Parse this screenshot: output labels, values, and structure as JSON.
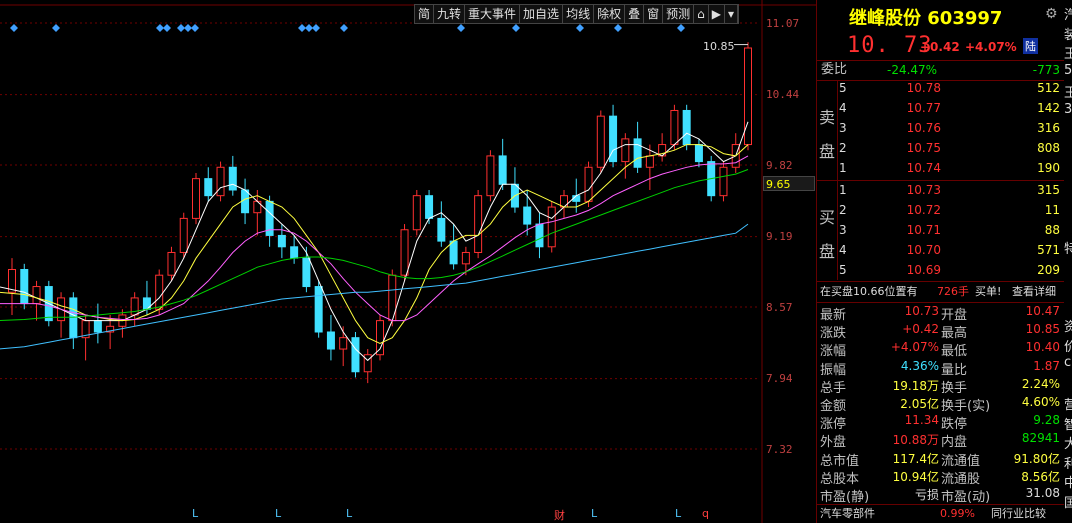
{
  "toolbar": {
    "items": [
      "简",
      "九转",
      "重大事件",
      "加自选",
      "均线",
      "除权",
      "叠",
      "窗",
      "预测",
      "⌂",
      "▶",
      "▾"
    ]
  },
  "chart": {
    "y_labels": [
      "11.07",
      "10.44",
      "9.82",
      "9.19",
      "8.57",
      "7.94",
      "7.32"
    ],
    "current_price_label": "9.65",
    "high_label": "10.85",
    "x_markers": [
      {
        "text": "L",
        "color": "cyan"
      },
      {
        "text": "L",
        "color": "cyan"
      },
      {
        "text": "L",
        "color": "cyan"
      },
      {
        "text": "财",
        "color": "red"
      },
      {
        "text": "L",
        "color": "cyan"
      },
      {
        "text": "L",
        "color": "cyan"
      },
      {
        "text": "q",
        "color": "red"
      }
    ]
  },
  "chart_data": {
    "type": "candlestick",
    "y_ticks": [
      11.07,
      10.44,
      9.82,
      9.19,
      8.57,
      7.94,
      7.32
    ],
    "ylim": [
      7.0,
      11.2
    ],
    "candles": [
      [
        8.7,
        9.0,
        8.5,
        8.9
      ],
      [
        8.9,
        8.95,
        8.55,
        8.6
      ],
      [
        8.6,
        8.8,
        8.45,
        8.75
      ],
      [
        8.75,
        8.8,
        8.4,
        8.45
      ],
      [
        8.45,
        8.7,
        8.3,
        8.65
      ],
      [
        8.65,
        8.7,
        8.2,
        8.3
      ],
      [
        8.3,
        8.5,
        8.1,
        8.45
      ],
      [
        8.45,
        8.6,
        8.25,
        8.35
      ],
      [
        8.35,
        8.5,
        8.2,
        8.4
      ],
      [
        8.4,
        8.55,
        8.3,
        8.5
      ],
      [
        8.5,
        8.7,
        8.4,
        8.65
      ],
      [
        8.65,
        8.8,
        8.5,
        8.55
      ],
      [
        8.55,
        8.9,
        8.5,
        8.85
      ],
      [
        8.85,
        9.1,
        8.8,
        9.05
      ],
      [
        9.05,
        9.4,
        9.0,
        9.35
      ],
      [
        9.35,
        9.75,
        9.3,
        9.7
      ],
      [
        9.7,
        9.8,
        9.5,
        9.55
      ],
      [
        9.55,
        9.85,
        9.5,
        9.8
      ],
      [
        9.8,
        9.9,
        9.55,
        9.6
      ],
      [
        9.6,
        9.7,
        9.3,
        9.4
      ],
      [
        9.4,
        9.6,
        9.2,
        9.5
      ],
      [
        9.5,
        9.55,
        9.1,
        9.2
      ],
      [
        9.2,
        9.3,
        9.0,
        9.1
      ],
      [
        9.1,
        9.2,
        8.95,
        9.0
      ],
      [
        9.0,
        9.1,
        8.7,
        8.75
      ],
      [
        8.75,
        8.8,
        8.3,
        8.35
      ],
      [
        8.35,
        8.5,
        8.1,
        8.2
      ],
      [
        8.2,
        8.4,
        8.05,
        8.3
      ],
      [
        8.3,
        8.35,
        7.95,
        8.0
      ],
      [
        8.0,
        8.2,
        7.9,
        8.15
      ],
      [
        8.15,
        8.5,
        8.1,
        8.45
      ],
      [
        8.45,
        8.9,
        8.4,
        8.85
      ],
      [
        8.85,
        9.3,
        8.8,
        9.25
      ],
      [
        9.25,
        9.6,
        9.2,
        9.55
      ],
      [
        9.55,
        9.6,
        9.3,
        9.35
      ],
      [
        9.35,
        9.5,
        9.1,
        9.15
      ],
      [
        9.15,
        9.3,
        8.9,
        8.95
      ],
      [
        8.95,
        9.1,
        8.85,
        9.05
      ],
      [
        9.05,
        9.6,
        9.0,
        9.55
      ],
      [
        9.55,
        9.95,
        9.5,
        9.9
      ],
      [
        9.9,
        10.05,
        9.6,
        9.65
      ],
      [
        9.65,
        9.8,
        9.4,
        9.45
      ],
      [
        9.45,
        9.6,
        9.2,
        9.3
      ],
      [
        9.3,
        9.4,
        9.0,
        9.1
      ],
      [
        9.1,
        9.5,
        9.05,
        9.45
      ],
      [
        9.45,
        9.6,
        9.35,
        9.55
      ],
      [
        9.55,
        9.7,
        9.4,
        9.5
      ],
      [
        9.5,
        9.85,
        9.45,
        9.8
      ],
      [
        9.8,
        10.3,
        9.75,
        10.25
      ],
      [
        10.25,
        10.35,
        9.8,
        9.85
      ],
      [
        9.85,
        10.1,
        9.7,
        10.05
      ],
      [
        10.05,
        10.2,
        9.75,
        9.8
      ],
      [
        9.8,
        10.0,
        9.6,
        9.9
      ],
      [
        9.9,
        10.1,
        9.85,
        10.0
      ],
      [
        10.0,
        10.35,
        9.95,
        10.3
      ],
      [
        10.3,
        10.35,
        9.95,
        10.0
      ],
      [
        10.0,
        10.05,
        9.8,
        9.85
      ],
      [
        9.85,
        9.9,
        9.5,
        9.55
      ],
      [
        9.55,
        9.85,
        9.5,
        9.8
      ],
      [
        9.8,
        10.1,
        9.75,
        10.0
      ],
      [
        10.0,
        10.9,
        9.95,
        10.85
      ]
    ],
    "ma_lines": {
      "white": [
        8.75,
        8.7,
        8.65,
        8.6,
        8.55,
        8.5,
        8.45,
        8.45,
        8.45,
        8.45,
        8.5,
        8.55,
        8.65,
        8.8,
        9.0,
        9.25,
        9.5,
        9.62,
        9.65,
        9.6,
        9.5,
        9.4,
        9.3,
        9.2,
        9.05,
        8.8,
        8.55,
        8.35,
        8.2,
        8.1,
        8.2,
        8.45,
        8.8,
        9.15,
        9.35,
        9.4,
        9.3,
        9.15,
        9.2,
        9.45,
        9.65,
        9.65,
        9.55,
        9.4,
        9.35,
        9.45,
        9.55,
        9.6,
        9.75,
        9.95,
        10.0,
        10.0,
        9.95,
        9.9,
        10.0,
        10.1,
        10.05,
        9.95,
        9.85,
        9.9,
        10.2
      ],
      "yellow": [
        8.7,
        8.68,
        8.65,
        8.62,
        8.58,
        8.55,
        8.5,
        8.48,
        8.46,
        8.45,
        8.46,
        8.5,
        8.55,
        8.65,
        8.8,
        9.0,
        9.15,
        9.3,
        9.45,
        9.52,
        9.55,
        9.5,
        9.45,
        9.35,
        9.2,
        9.05,
        8.85,
        8.65,
        8.45,
        8.3,
        8.25,
        8.3,
        8.45,
        8.65,
        8.9,
        9.05,
        9.15,
        9.2,
        9.2,
        9.3,
        9.45,
        9.55,
        9.6,
        9.55,
        9.5,
        9.45,
        9.45,
        9.5,
        9.6,
        9.7,
        9.8,
        9.88,
        9.9,
        9.92,
        9.95,
        10.0,
        10.0,
        9.98,
        9.92,
        9.9,
        10.0
      ],
      "purple": [
        8.6,
        8.6,
        8.6,
        8.58,
        8.55,
        8.52,
        8.5,
        8.48,
        8.47,
        8.46,
        8.46,
        8.47,
        8.5,
        8.55,
        8.6,
        8.7,
        8.8,
        8.92,
        9.05,
        9.15,
        9.22,
        9.25,
        9.25,
        9.22,
        9.15,
        9.05,
        8.95,
        8.82,
        8.7,
        8.6,
        8.5,
        8.45,
        8.45,
        8.5,
        8.6,
        8.7,
        8.8,
        8.88,
        8.95,
        9.02,
        9.1,
        9.18,
        9.25,
        9.3,
        9.32,
        9.35,
        9.38,
        9.42,
        9.48,
        9.55,
        9.6,
        9.65,
        9.7,
        9.74,
        9.77,
        9.8,
        9.82,
        9.83,
        9.83,
        9.84,
        9.9
      ],
      "green": [
        8.45,
        8.46,
        8.47,
        8.48,
        8.48,
        8.48,
        8.49,
        8.5,
        8.51,
        8.52,
        8.53,
        8.55,
        8.57,
        8.6,
        8.63,
        8.67,
        8.72,
        8.77,
        8.82,
        8.87,
        8.92,
        8.95,
        8.98,
        9.0,
        9.01,
        9.01,
        9.0,
        8.98,
        8.95,
        8.92,
        8.88,
        8.85,
        8.83,
        8.82,
        8.82,
        8.83,
        8.85,
        8.88,
        8.92,
        8.97,
        9.02,
        9.07,
        9.12,
        9.17,
        9.22,
        9.26,
        9.3,
        9.34,
        9.38,
        9.42,
        9.46,
        9.5,
        9.54,
        9.58,
        9.62,
        9.65,
        9.68,
        9.7,
        9.72,
        9.74,
        9.78
      ],
      "blue": [
        8.2,
        8.22,
        8.24,
        8.26,
        8.28,
        8.3,
        8.32,
        8.34,
        8.36,
        8.38,
        8.4,
        8.42,
        8.44,
        8.46,
        8.48,
        8.5,
        8.52,
        8.54,
        8.56,
        8.58,
        8.6,
        8.62,
        8.64,
        8.65,
        8.66,
        8.67,
        8.68,
        8.69,
        8.7,
        8.7,
        8.71,
        8.72,
        8.73,
        8.74,
        8.75,
        8.76,
        8.77,
        8.78,
        8.8,
        8.82,
        8.84,
        8.86,
        8.88,
        8.9,
        8.92,
        8.94,
        8.96,
        8.98,
        9.0,
        9.02,
        9.04,
        9.06,
        9.08,
        9.1,
        9.12,
        9.14,
        9.16,
        9.18,
        9.2,
        9.22,
        9.3
      ]
    }
  },
  "panel": {
    "title": "继峰股份 603997",
    "price": "10. 73",
    "change": "+0.42",
    "change_pct": "+4.07%",
    "lu_tag": "陆",
    "weibi_label": "委比",
    "weibi_pct": "-24.47%",
    "weibi_val": "-773",
    "sell_label": [
      "卖",
      "盘"
    ],
    "buy_label": [
      "买",
      "盘"
    ],
    "asks": [
      {
        "level": "5",
        "price": "10.78",
        "vol": "512"
      },
      {
        "level": "4",
        "price": "10.77",
        "vol": "142"
      },
      {
        "level": "3",
        "price": "10.76",
        "vol": "316"
      },
      {
        "level": "2",
        "price": "10.75",
        "vol": "808"
      },
      {
        "level": "1",
        "price": "10.74",
        "vol": "190"
      }
    ],
    "bids": [
      {
        "level": "1",
        "price": "10.73",
        "vol": "315"
      },
      {
        "level": "2",
        "price": "10.72",
        "vol": "11"
      },
      {
        "level": "3",
        "price": "10.71",
        "vol": "88"
      },
      {
        "level": "4",
        "price": "10.70",
        "vol": "571"
      },
      {
        "level": "5",
        "price": "10.69",
        "vol": "209"
      }
    ],
    "notice": {
      "text": "在买盘10.66位置有",
      "qty": "726手",
      "action": "买单!",
      "link": "查看详细"
    },
    "quote_rows": [
      {
        "l1": "最新",
        "v1": "10.73",
        "c1": "red",
        "l2": "开盘",
        "v2": "10.47",
        "c2": "red"
      },
      {
        "l1": "涨跌",
        "v1": "+0.42",
        "c1": "red",
        "l2": "最高",
        "v2": "10.85",
        "c2": "red"
      },
      {
        "l1": "涨幅",
        "v1": "+4.07%",
        "c1": "red",
        "l2": "最低",
        "v2": "10.40",
        "c2": "red"
      },
      {
        "l1": "振幅",
        "v1": "4.36%",
        "c1": "cyan",
        "l2": "量比",
        "v2": "1.87",
        "c2": "red"
      },
      {
        "l1": "总手",
        "v1": "19.18万",
        "c1": "yellow",
        "l2": "换手",
        "v2": "2.24%",
        "c2": "yellow"
      },
      {
        "l1": "金额",
        "v1": "2.05亿",
        "c1": "yellow",
        "l2": "换手(实)",
        "v2": "4.60%",
        "c2": "yellow"
      },
      {
        "l1": "涨停",
        "v1": "11.34",
        "c1": "red",
        "l2": "跌停",
        "v2": "9.28",
        "c2": "green"
      },
      {
        "l1": "外盘",
        "v1": "10.88万",
        "c1": "red",
        "l2": "内盘",
        "v2": "82941",
        "c2": "green"
      },
      {
        "l1": "总市值",
        "v1": "117.4亿",
        "c1": "yellow",
        "l2": "流通值",
        "v2": "91.80亿",
        "c2": "yellow"
      },
      {
        "l1": "总股本",
        "v1": "10.94亿",
        "c1": "yellow",
        "l2": "流通股",
        "v2": "8.56亿",
        "c2": "yellow"
      },
      {
        "l1": "市盈(静)",
        "v1": "亏损",
        "c1": "white",
        "l2": "市盈(动)",
        "v2": "31.08",
        "c2": "white"
      }
    ],
    "footer": {
      "sector": "汽车零部件",
      "sector_pct": "0.99%",
      "compare": "同行业比较"
    }
  },
  "edge_chars": [
    "汽",
    "装",
    "王",
    "5",
    "王",
    "3",
    "",
    "",
    "",
    "",
    "",
    "",
    "特",
    "",
    "",
    "",
    "资",
    "价",
    "c",
    "",
    "营",
    "智",
    "大",
    "利",
    "中",
    "国"
  ],
  "colors": {
    "up": "#ff3030",
    "down": "#40e0ff",
    "bg": "#000000",
    "grid": "#600000"
  }
}
